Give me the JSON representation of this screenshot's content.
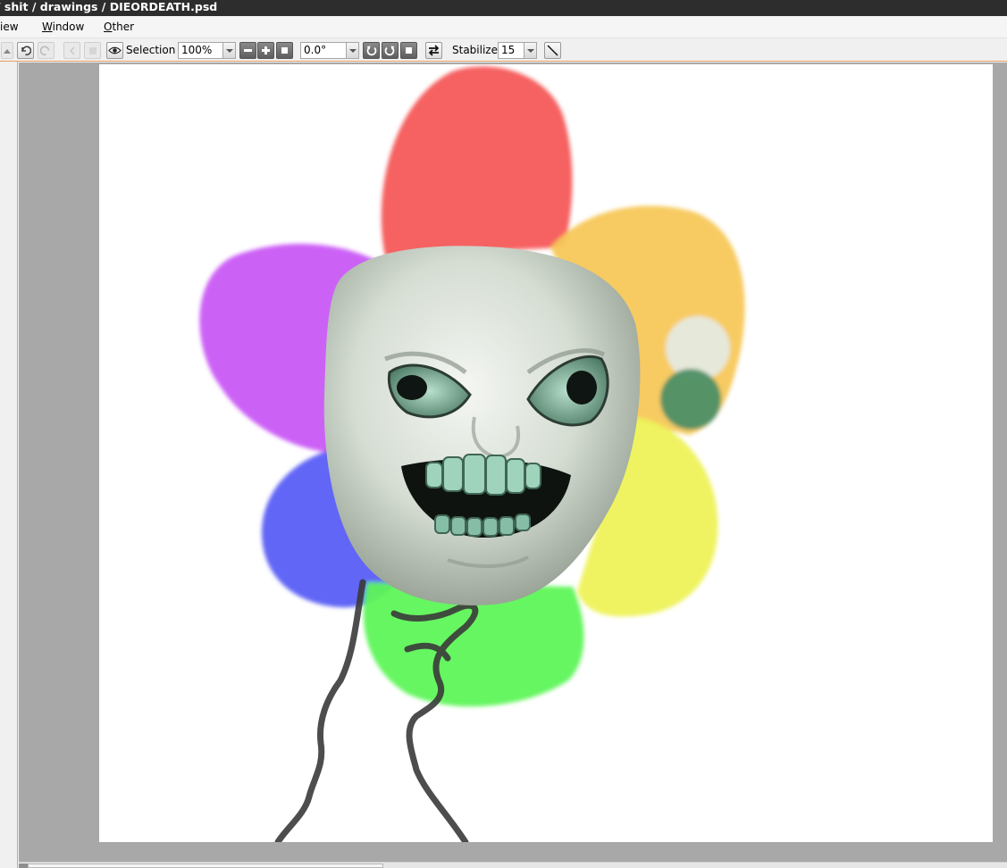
{
  "window": {
    "title": "/ shit / drawings / DIEORDEATH.psd"
  },
  "menu": {
    "items": [
      {
        "label": "View",
        "visible_label": "iew",
        "access_key": ""
      },
      {
        "label": "Window",
        "access_key": "W",
        "rest": "indow"
      },
      {
        "label": "Other",
        "access_key": "O",
        "rest": "ther"
      }
    ]
  },
  "toolbar": {
    "selection_label": "Selection",
    "zoom_value": "100%",
    "rotation_value": "0.0°",
    "stabilizer_label": "Stabilizer",
    "stabilizer_value": "15",
    "icons": [
      "scroll-up-icon",
      "undo-icon",
      "redo-icon",
      "prev-icon",
      "next-icon",
      "eye-icon",
      "minus-icon",
      "plus-icon",
      "reset-icon",
      "rotate-left-icon",
      "rotate-right-icon",
      "reset-rotation-icon",
      "flip-icon",
      "line-icon"
    ]
  },
  "canvas": {
    "description_colors": {
      "petal_red": "#f55a5a",
      "petal_orange": "#f7c85a",
      "petal_yellow": "#eef25a",
      "petal_green": "#5ef55a",
      "petal_blue": "#5a5ef5",
      "petal_purple": "#c95af5",
      "face": "#dfe5de",
      "stem": "#3a3a3a"
    }
  }
}
